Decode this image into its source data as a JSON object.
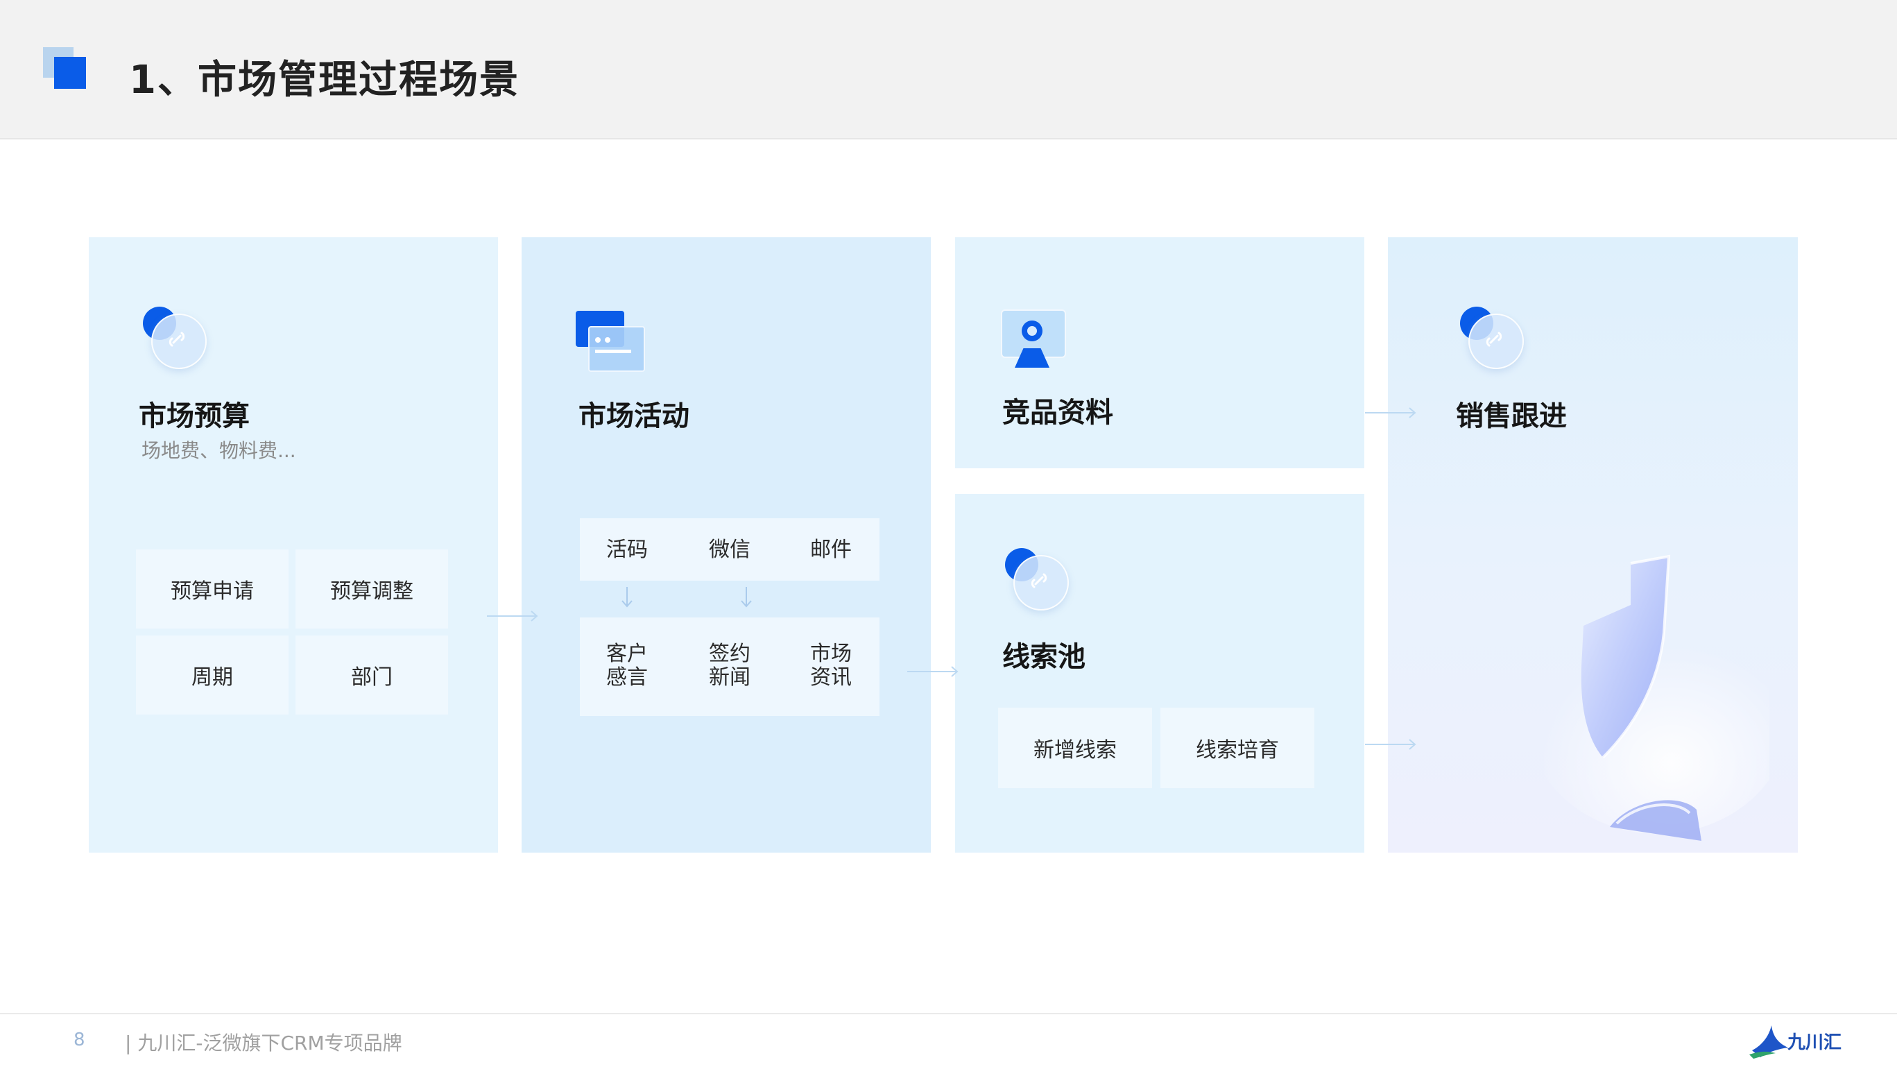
{
  "header": {
    "title": "1、市场管理过程场景"
  },
  "cards": {
    "budget": {
      "title": "市场预算",
      "subtitle": "场地费、物料费...",
      "items": [
        "预算申请",
        "预算调整",
        "周期",
        "部门"
      ]
    },
    "activity": {
      "title": "市场活动",
      "channels": [
        "活码",
        "微信",
        "邮件"
      ],
      "outputs": [
        "客户\n感言",
        "签约\n新闻",
        "市场\n资讯"
      ]
    },
    "competitor": {
      "title": "竞品资料"
    },
    "leads": {
      "title": "线索池",
      "items": [
        "新增线索",
        "线索培育"
      ]
    },
    "sales": {
      "title": "销售跟进"
    }
  },
  "footer": {
    "page_number": "8",
    "text": "| 九川汇-泛微旗下CRM专项品牌",
    "logo_text": "九川汇"
  },
  "colors": {
    "accent": "#0a5ce8",
    "card_light": "#e5f4fd",
    "arrow": "#bcd9f2"
  }
}
